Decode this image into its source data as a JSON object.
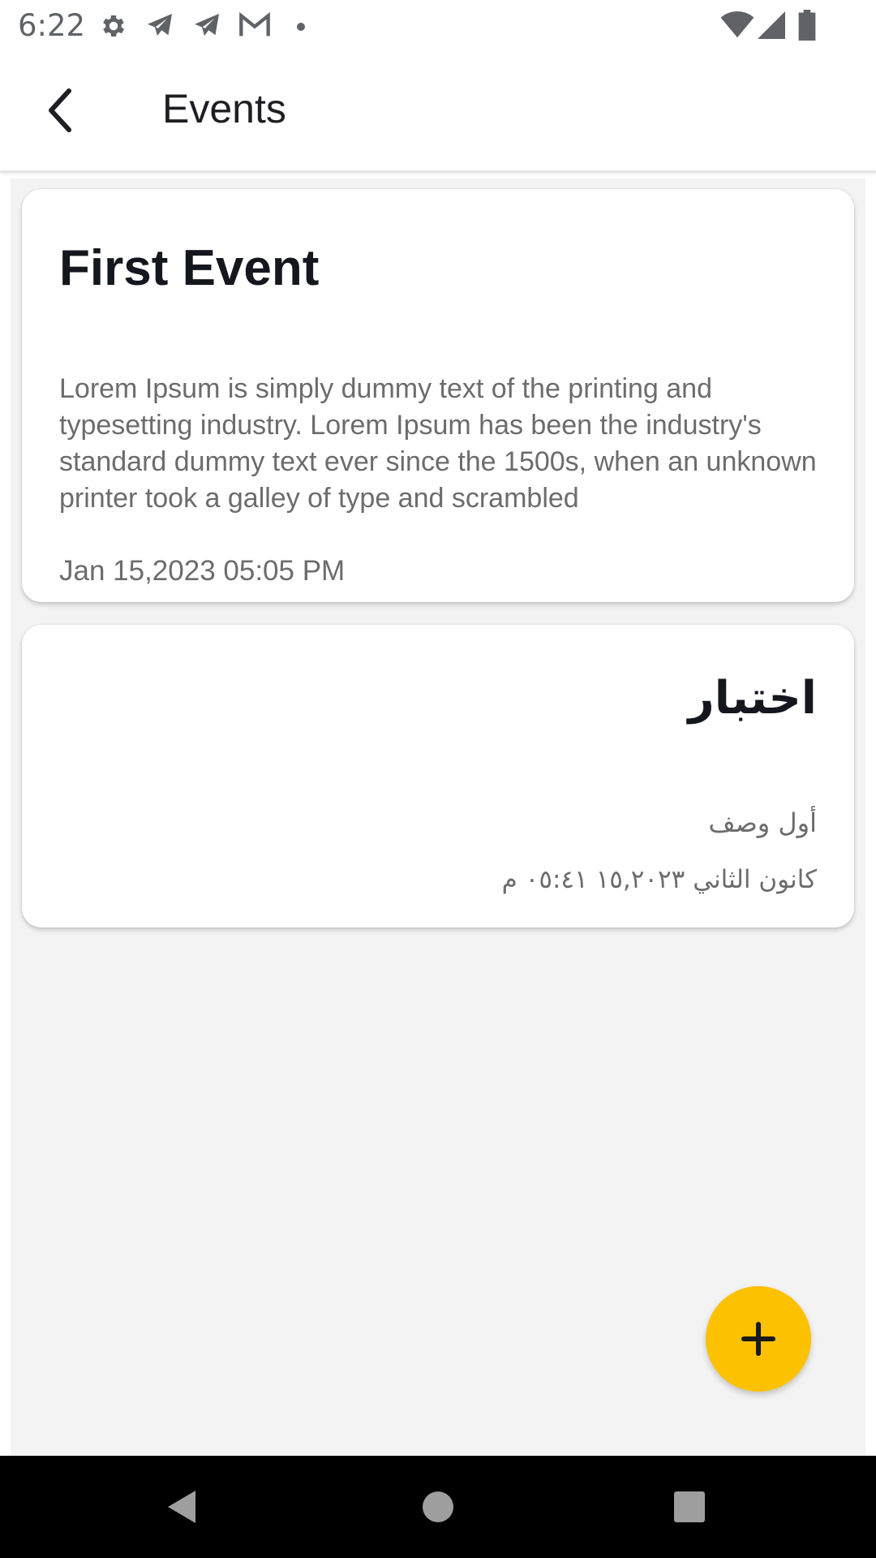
{
  "status_bar": {
    "time": "6:22",
    "left_icons": [
      "settings-icon",
      "telegram-icon",
      "telegram-icon",
      "gmail-icon",
      "dot-icon"
    ],
    "right_icons": [
      "wifi-icon",
      "signal-icon",
      "battery-icon"
    ]
  },
  "app_bar": {
    "title": "Events",
    "back_icon": "back-arrow-icon"
  },
  "events": [
    {
      "title": "First Event",
      "description": "Lorem Ipsum is simply dummy text of the printing and typesetting industry. Lorem Ipsum has been the industry's standard dummy text ever since the 1500s, when an unknown printer took a galley of type and scrambled",
      "datetime": "Jan 15,2023  05:05 PM"
    },
    {
      "title": "اختبار",
      "description": "أول وصف",
      "datetime": "كانون الثاني ١٥,٢٠٢٣  ٠٥:٤١ م"
    }
  ],
  "fab": {
    "icon": "plus-icon",
    "color": "#fcc100"
  },
  "nav_bar": {
    "buttons": [
      "back-triangle-icon",
      "home-circle-icon",
      "recents-square-icon"
    ]
  }
}
